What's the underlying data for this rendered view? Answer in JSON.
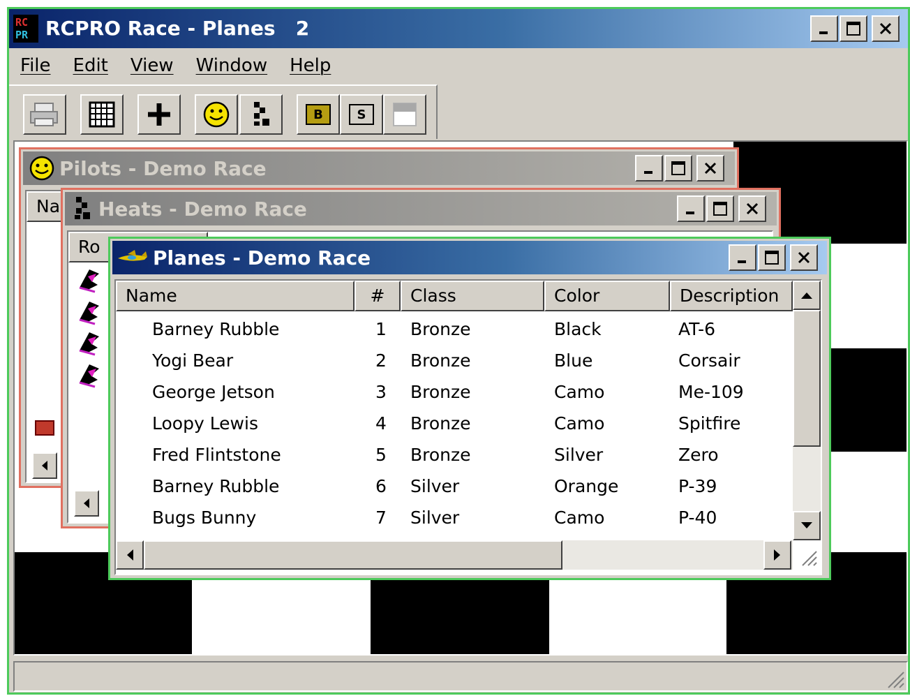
{
  "app": {
    "logo_top": "RC",
    "logo_bottom": "PR",
    "title": "RCPRO Race - Planes   2"
  },
  "menu": [
    "File",
    "Edit",
    "View",
    "Window",
    "Help"
  ],
  "toolbar": {
    "buttons": [
      "print-icon",
      "grid-icon",
      "add-icon",
      "pilots-smiley-icon",
      "heats-checker-icon",
      "b-icon",
      "s-icon",
      "window-icon"
    ],
    "b_label": "B",
    "s_label": "S"
  },
  "pilots_window": {
    "title": "Pilots - Demo Race",
    "first_column_partial": "Na"
  },
  "heats_window": {
    "title": "Heats - Demo Race",
    "first_column_partial": "Ro"
  },
  "planes_window": {
    "title": "Planes - Demo Race",
    "columns": [
      "Name",
      "#",
      "Class",
      "Color",
      "Description"
    ],
    "rows": [
      [
        "Barney Rubble",
        "1",
        "Bronze",
        "Black",
        "AT-6"
      ],
      [
        "Yogi Bear",
        "2",
        "Bronze",
        "Blue",
        "Corsair"
      ],
      [
        "George Jetson",
        "3",
        "Bronze",
        "Camo",
        "Me-109"
      ],
      [
        "Loopy Lewis",
        "4",
        "Bronze",
        "Camo",
        "Spitfire"
      ],
      [
        "Fred Flintstone",
        "5",
        "Bronze",
        "Silver",
        "Zero"
      ],
      [
        "Barney Rubble",
        "6",
        "Silver",
        "Orange",
        "P-39"
      ],
      [
        "Bugs Bunny",
        "7",
        "Silver",
        "Camo",
        "P-40"
      ]
    ]
  },
  "colors": {
    "active_title_start": "#0a246a",
    "active_title_end": "#a6caf0",
    "inactive_border": "#e07060",
    "active_border": "#4dca5b",
    "face": "#d4d0c8"
  }
}
